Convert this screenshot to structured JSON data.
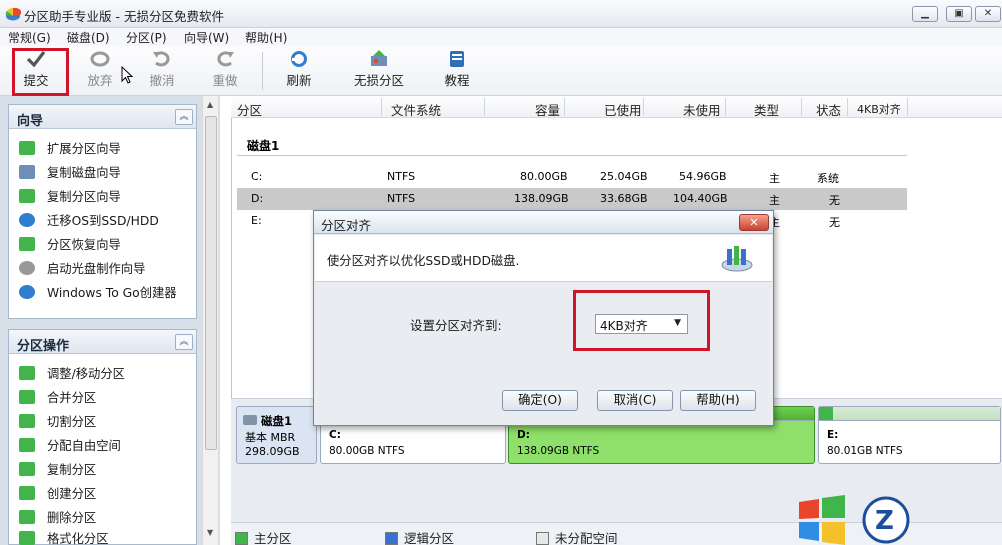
{
  "window": {
    "title": "分区助手专业版 - 无损分区免费软件",
    "controls": [
      "minimize",
      "restore",
      "close"
    ]
  },
  "menu": [
    "常规(G)",
    "磁盘(D)",
    "分区(P)",
    "向导(W)",
    "帮助(H)"
  ],
  "toolbar": {
    "submit": "提交",
    "discard": "放弃",
    "undo": "撤消",
    "redo": "重做",
    "refresh": "刷新",
    "lossless": "无损分区",
    "tutorial": "教程"
  },
  "wizard_panel": {
    "title": "向导",
    "items": [
      "扩展分区向导",
      "复制磁盘向导",
      "复制分区向导",
      "迁移OS到SSD/HDD",
      "分区恢复向导",
      "启动光盘制作向导",
      "Windows To Go创建器"
    ]
  },
  "ops_panel": {
    "title": "分区操作",
    "items": [
      "调整/移动分区",
      "合并分区",
      "切割分区",
      "分配自由空间",
      "复制分区",
      "创建分区",
      "删除分区",
      "格式化分区"
    ]
  },
  "columns": [
    "分区",
    "文件系统",
    "容量",
    "已使用",
    "未使用",
    "类型",
    "状态",
    "4KB对齐"
  ],
  "disk_label": "磁盘1",
  "partitions": [
    {
      "name": "C:",
      "fs": "NTFS",
      "capacity": "80.00GB",
      "used": "25.04GB",
      "free": "54.96GB",
      "type": "主",
      "status": "系统"
    },
    {
      "name": "D:",
      "fs": "NTFS",
      "capacity": "138.09GB",
      "used": "33.68GB",
      "free": "104.40GB",
      "type": "主",
      "status": "无"
    },
    {
      "name": "E:",
      "fs": "",
      "capacity": "",
      "used": "",
      "free": "",
      "type": "主",
      "status": "无"
    }
  ],
  "disk_map": {
    "disk_name": "磁盘1",
    "disk_type": "基本 MBR",
    "disk_size": "298.09GB",
    "parts": [
      {
        "label": "C:",
        "size": "80.00GB NTFS"
      },
      {
        "label": "D:",
        "size": "138.09GB NTFS"
      },
      {
        "label": "E:",
        "size": "80.01GB NTFS"
      }
    ]
  },
  "legend": [
    "主分区",
    "逻辑分区",
    "未分配空间"
  ],
  "dialog": {
    "title": "分区对齐",
    "description": "使分区对齐以优化SSD或HDD磁盘.",
    "label": "设置分区对齐到:",
    "selected": "4KB对齐",
    "ok": "确定(O)",
    "cancel": "取消(C)",
    "help": "帮助(H)"
  },
  "colors": {
    "primary_part": "#3fb54a",
    "logical_part": "#3b6fd1",
    "unallocated": "#e8e8e8",
    "highlight_box": "#d2142a",
    "selected_bar": "#8ee06a"
  }
}
